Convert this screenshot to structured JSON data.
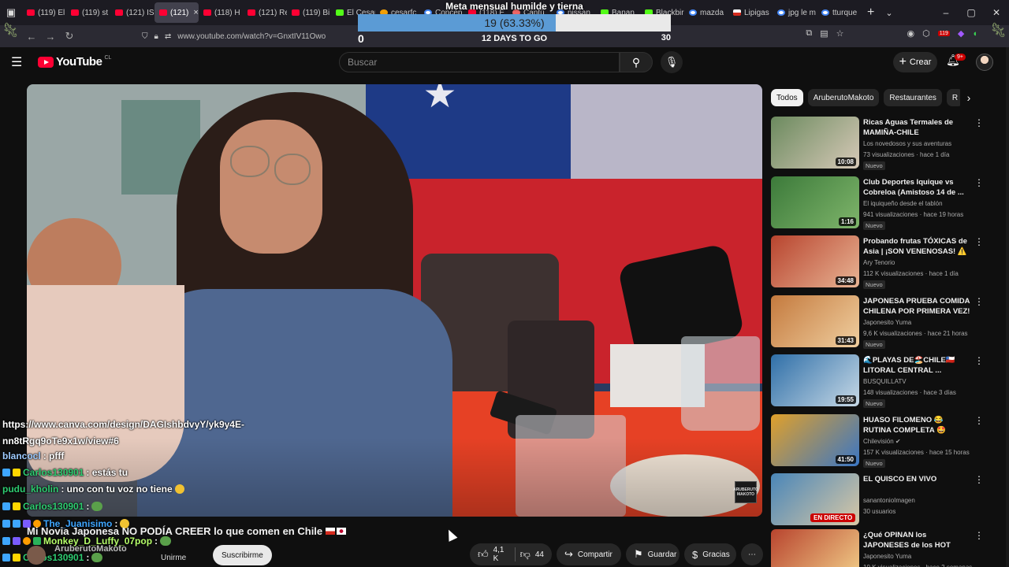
{
  "browser": {
    "tabs": [
      {
        "label": "(119) El",
        "icon": "youtube-icon",
        "active": false
      },
      {
        "label": "(119) st",
        "icon": "youtube-icon",
        "active": false
      },
      {
        "label": "(121) IS",
        "icon": "youtube-icon",
        "active": false
      },
      {
        "label": "(121)",
        "icon": "youtube-icon",
        "active": true
      },
      {
        "label": "(118) H",
        "icon": "youtube-icon",
        "active": false
      },
      {
        "label": "(121) Re",
        "icon": "youtube-icon",
        "active": false
      },
      {
        "label": "(119) Bi",
        "icon": "youtube-icon",
        "active": false
      },
      {
        "label": "El Cesar",
        "icon": "kick-icon",
        "active": false
      },
      {
        "label": "cesarfc",
        "icon": "firefox-icon",
        "active": false
      },
      {
        "label": "Concep",
        "icon": "globe-icon",
        "active": false
      },
      {
        "label": "(118) E",
        "icon": "youtube-icon",
        "active": false
      },
      {
        "label": "Cantú",
        "icon": "misc-icon",
        "active": false
      },
      {
        "label": "nissan",
        "icon": "google-icon",
        "active": false
      },
      {
        "label": "Banan",
        "icon": "kick-icon",
        "active": false
      },
      {
        "label": "Blackbir",
        "icon": "kick-icon",
        "active": false
      },
      {
        "label": "mazda",
        "icon": "google-icon",
        "active": false
      },
      {
        "label": "Lipigas",
        "icon": "chile-icon",
        "active": false
      },
      {
        "label": "jpg le m",
        "icon": "google-icon",
        "active": false
      },
      {
        "label": "tturque",
        "icon": "google-icon",
        "active": false
      }
    ],
    "tab_close": "×",
    "new_tab": "+",
    "tab_list": "⌄",
    "window": {
      "minimize": "–",
      "maximize": "▢",
      "close": "✕"
    },
    "nav": {
      "back": "←",
      "forward": "→",
      "reload": "↻"
    },
    "url": "www.youtube.com/watch?v=GnxtIV11Owo",
    "extension_badge": "119"
  },
  "goal": {
    "title": "Meta mensual humilde y tierna",
    "current_label": "19 (63.33%)",
    "progress": 0.6333,
    "min": "0",
    "max": "30",
    "days_left": "12 DAYS TO GO"
  },
  "header": {
    "logo_text": "YouTube",
    "country_code": "CL",
    "search_placeholder": "Buscar",
    "create_label": "Crear",
    "notification_count": "9+"
  },
  "video": {
    "watermark": "ARUBERUTO MAKOTO",
    "title": "Mi Novia Japonesa NO PODÍA CREER lo que comen en Chile",
    "owner_name": "AruberutoMakoto",
    "unsubscribe_label": "Unirme",
    "subscribe_label": "Suscribirme",
    "likes": "4,1 K",
    "dislikes": "44",
    "share_label": "Compartir",
    "save_label": "Guardar",
    "thanks_label": "Gracias"
  },
  "chat": [
    {
      "user": "",
      "text": "https://www.canva.com/design/DAGIshbdvyY/yk9y4E-",
      "color": "#ffffff"
    },
    {
      "user": "",
      "text": "nn8tRgq9oTe9x1w/view#6",
      "color": "#ffffff"
    },
    {
      "user": "blancocl",
      "text": ": pfff",
      "color": "#9ecbff"
    },
    {
      "user": "Carlos130901",
      "text": ": estás tu",
      "color": "#2ecc71"
    },
    {
      "user": "pudu_kholin",
      "text": ": uno con tu voz no tiene",
      "color": "#2ecc71"
    },
    {
      "user": "Carlos130901",
      "text": ":",
      "color": "#2ecc71"
    },
    {
      "user": "The_Juanisimo",
      "text": ":",
      "color": "#3ea6ff"
    },
    {
      "user": "Monkey_D_Luffy_07pop",
      "text": ":",
      "color": "#b6ff6a"
    },
    {
      "user": "Carlos130901",
      "text": ":",
      "color": "#2ecc71"
    }
  ],
  "chips": [
    "Todos",
    "AruberutoMakoto",
    "Restaurantes",
    "R"
  ],
  "recommendations": [
    {
      "title": "Ricas Aguas Termales de MAMIÑA-CHILE",
      "channel": "Los novedosos y sus aventuras",
      "meta": "73 visualizaciones · hace 1 día",
      "badge": "Nuevo",
      "duration": "10:08",
      "live": false,
      "thumb_colors": [
        "#6b8a5e",
        "#d7c9b8"
      ]
    },
    {
      "title": "Club Deportes Iquique vs Cobreloa (Amistoso 14 de ...",
      "channel": "El iquiqueño desde el tablón",
      "meta": "941 visualizaciones · hace 19 horas",
      "badge": "Nuevo",
      "duration": "1:16",
      "live": false,
      "thumb_colors": [
        "#3c7a3a",
        "#7fb56b"
      ]
    },
    {
      "title": "Probando frutas TÓXICAS de Asia | ¡SON VENENOSAS! ⚠️ ☠️",
      "channel": "Ary Tenorio",
      "meta": "112 K visualizaciones · hace 1 día",
      "badge": "Nuevo",
      "duration": "34:48",
      "live": false,
      "thumb_colors": [
        "#b8442e",
        "#e8b494"
      ]
    },
    {
      "title": "JAPONESA PRUEBA COMIDA CHILENA POR PRIMERA VEZ! | ...",
      "channel": "Japonesito Yuma",
      "meta": "9,6 K visualizaciones · hace 21 horas",
      "badge": "Nuevo",
      "duration": "31:43",
      "live": false,
      "thumb_colors": [
        "#c47a3e",
        "#f0cfa0"
      ]
    },
    {
      "title": "🌊PLAYAS DE🏖️CHILE🇨🇱 LITORAL CENTRAL ...",
      "channel": "BUSQUILLATV",
      "meta": "148 visualizaciones · hace 3 días",
      "badge": "Nuevo",
      "duration": "19:55",
      "live": false,
      "thumb_colors": [
        "#2f6fa8",
        "#c7d9e6"
      ]
    },
    {
      "title": "HUASO FILOMENO 😂 RUTINA COMPLETA 🤩 Festival de la ...",
      "channel": "Chilevisión ✔",
      "meta": "157 K visualizaciones · hace 15 horas",
      "badge": "Nuevo",
      "duration": "41:50",
      "live": false,
      "thumb_colors": [
        "#e0a02a",
        "#3a76c4"
      ]
    },
    {
      "title": "EL QUISCO EN VIVO",
      "channel": "sanantonioImagen",
      "meta": "30 usuarios",
      "badge": "",
      "duration": "",
      "live_label": "EN DIRECTO",
      "live": true,
      "thumb_colors": [
        "#4a86b8",
        "#d8c8a6"
      ]
    },
    {
      "title": "¿Qué OPINAN los JAPONESES de los HOT DOGS CHILENOS? ...",
      "channel": "Japonesito Yuma",
      "meta": "10 K visualizaciones · hace 2 semanas",
      "badge": "",
      "duration": "",
      "live": false,
      "thumb_colors": [
        "#b8442e",
        "#f3d18b"
      ]
    }
  ],
  "colors": {
    "background": "#0f0f0f",
    "youtube_red": "#ff0033",
    "goal_fill": "#5b9bd5",
    "goal_track": "#e9e9e9",
    "chip_active": "#f1f1f1"
  }
}
